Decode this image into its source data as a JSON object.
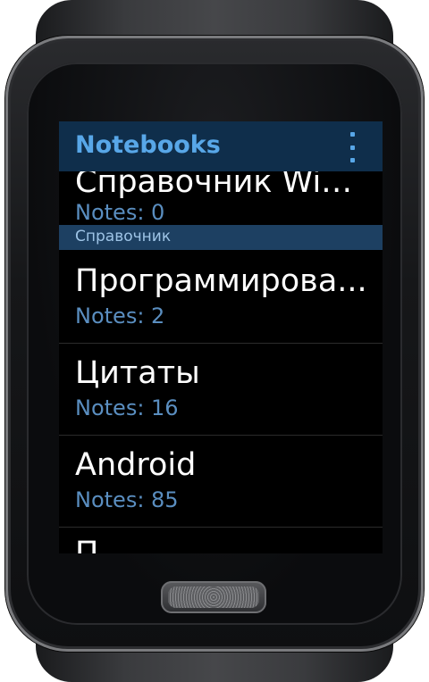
{
  "app_bar": {
    "title": "Notebooks",
    "overflow_icon": "overflow-menu-icon"
  },
  "list": {
    "partial_top": {
      "title": "Справочник Win...",
      "subtitle": "Notes: 0"
    },
    "section_header": "Справочник",
    "items": [
      {
        "title": "Программирова...",
        "subtitle": "Notes: 2"
      },
      {
        "title": "Цитаты",
        "subtitle": "Notes: 16"
      },
      {
        "title": "Android",
        "subtitle": "Notes: 85"
      }
    ],
    "partial_bottom": {
      "title": "П"
    }
  },
  "colors": {
    "app_bar_bg": "#0f2e4b",
    "accent": "#58a7e8",
    "subtitle": "#5a8ec0",
    "section_bg": "#1d4062"
  }
}
